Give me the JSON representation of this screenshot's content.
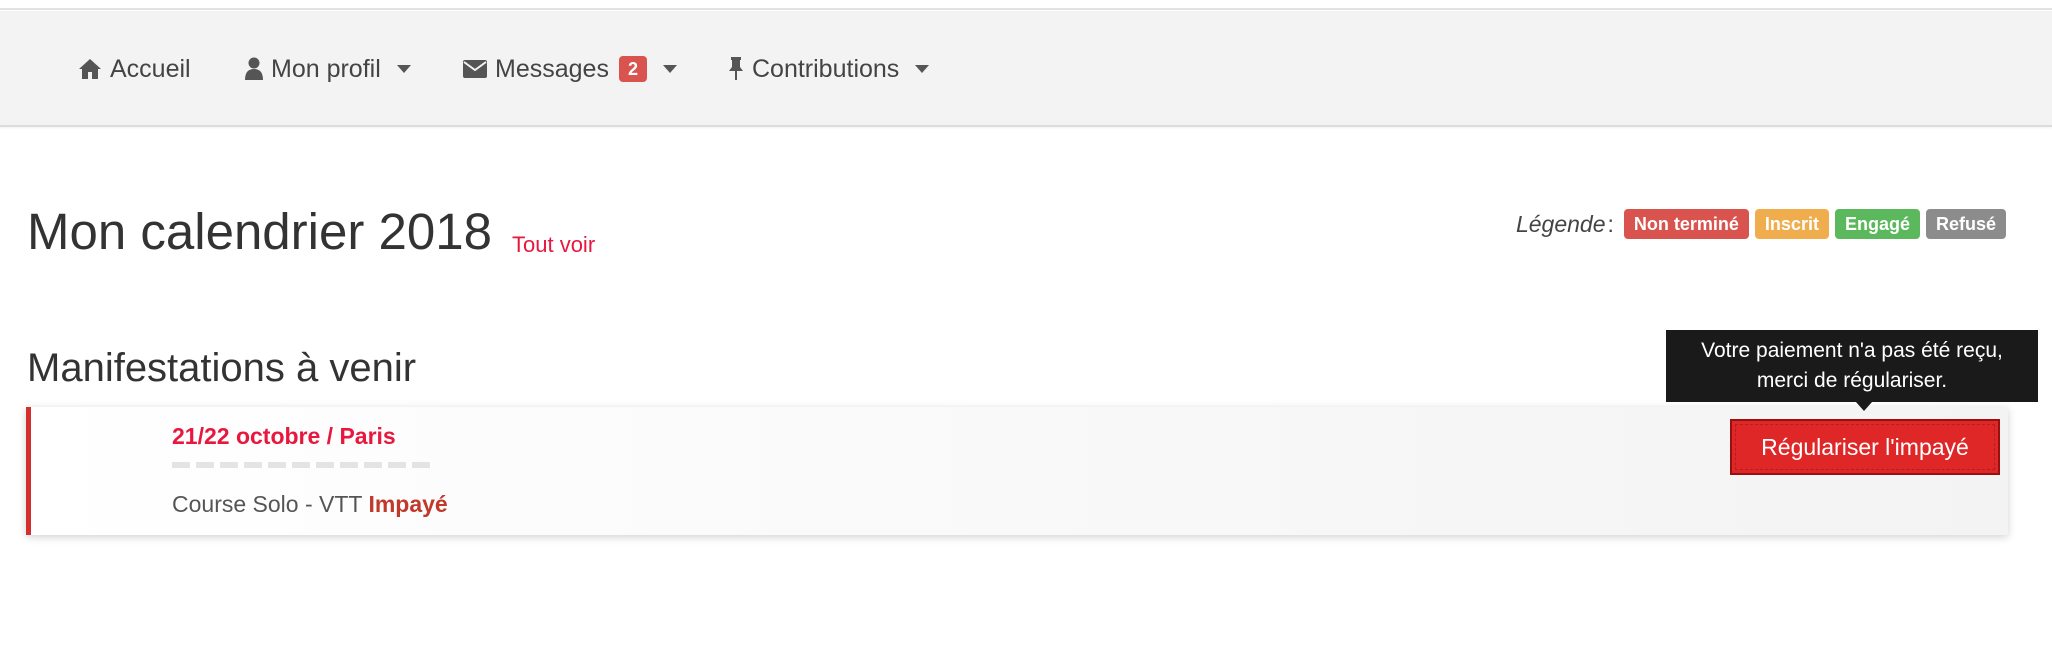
{
  "nav": {
    "items": [
      {
        "label": "Accueil",
        "icon": "home-icon"
      },
      {
        "label": "Mon profil",
        "icon": "user-icon"
      },
      {
        "label": "Messages",
        "icon": "envelope-icon",
        "badge": "2"
      },
      {
        "label": "Contributions",
        "icon": "pushpin-icon"
      }
    ]
  },
  "header": {
    "title": "Mon calendrier 2018",
    "see_all": "Tout voir"
  },
  "legend": {
    "title": "Légende",
    "colon": ":",
    "items": [
      {
        "label": "Non terminé",
        "color": "#d9534f"
      },
      {
        "label": "Inscrit",
        "color": "#f0ad4e"
      },
      {
        "label": "Engagé",
        "color": "#5cb85c"
      },
      {
        "label": "Refusé",
        "color": "#8c8c8c"
      }
    ]
  },
  "section": {
    "title": "Manifestations à venir"
  },
  "event": {
    "date_place": "21/22 octobre / Paris",
    "race": "Course Solo - VTT",
    "status": "Impayé",
    "action": "Régulariser l'impayé",
    "tooltip_line1": "Votre paiement n'a pas été reçu,",
    "tooltip_line2": "merci de régulariser."
  }
}
